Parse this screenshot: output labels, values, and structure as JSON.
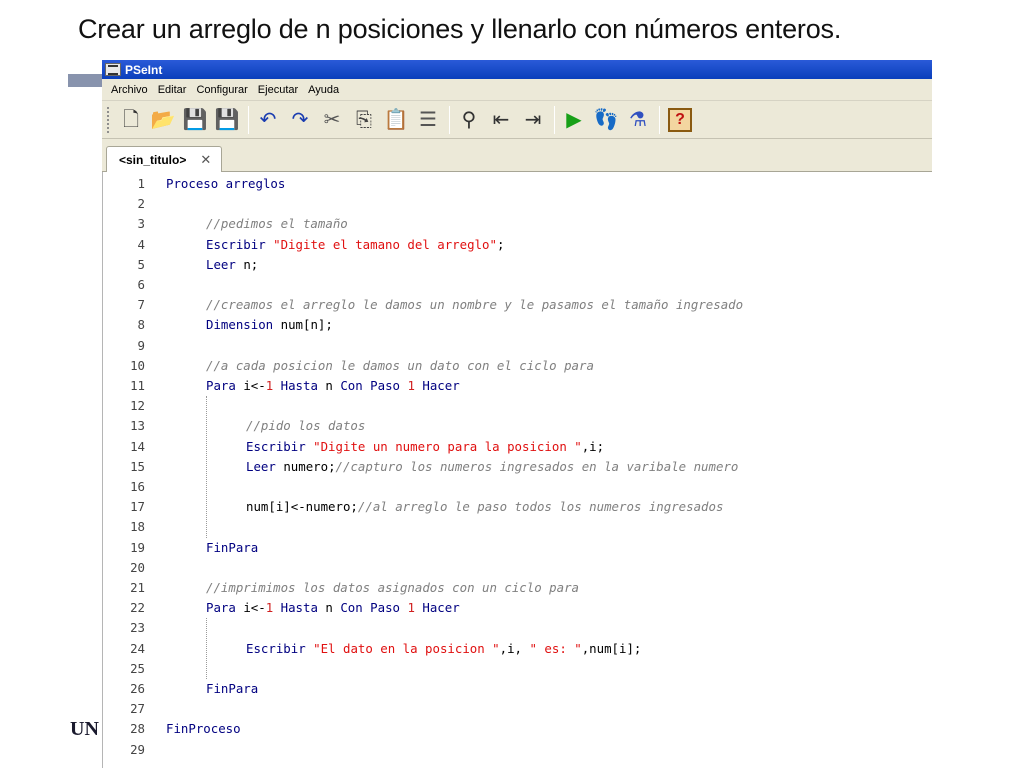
{
  "slide": {
    "title": "Crear un arreglo de n posiciones y llenarlo con números enteros.",
    "footer_fragment": "UN"
  },
  "window": {
    "title": "PSeInt"
  },
  "menu": [
    "Archivo",
    "Editar",
    "Configurar",
    "Ejecutar",
    "Ayuda"
  ],
  "toolbar": [
    {
      "name": "new-file-icon",
      "glyph": "🗋",
      "color": "#333333"
    },
    {
      "name": "open-file-icon",
      "glyph": "📂",
      "color": "#c08a10"
    },
    {
      "name": "save-icon",
      "glyph": "💾",
      "color": "#b02020"
    },
    {
      "name": "save-as-icon",
      "glyph": "💾",
      "color": "#b02020"
    },
    {
      "sep": true
    },
    {
      "name": "undo-icon",
      "glyph": "↶",
      "color": "#1a3cb0"
    },
    {
      "name": "redo-icon",
      "glyph": "↷",
      "color": "#1a3cb0"
    },
    {
      "name": "cut-icon",
      "glyph": "✂",
      "color": "#555555"
    },
    {
      "name": "copy-icon",
      "glyph": "⎘",
      "color": "#444444"
    },
    {
      "name": "paste-icon",
      "glyph": "📋",
      "color": "#8a6a20"
    },
    {
      "name": "indent-icon",
      "glyph": "☰",
      "color": "#555555"
    },
    {
      "sep": true
    },
    {
      "name": "find-icon",
      "glyph": "⚲",
      "color": "#333333"
    },
    {
      "name": "find-previous-icon",
      "glyph": "⇤",
      "color": "#333333"
    },
    {
      "name": "find-next-icon",
      "glyph": "⇥",
      "color": "#333333"
    },
    {
      "sep": true
    },
    {
      "name": "run-icon",
      "glyph": "▶",
      "color": "#18a018"
    },
    {
      "name": "step-by-step-icon",
      "glyph": "👣",
      "color": "#d06020"
    },
    {
      "name": "flowchart-icon",
      "glyph": "⚗",
      "color": "#3050c0"
    },
    {
      "sep": true
    },
    {
      "name": "help-icon",
      "glyph": "?",
      "color": "#c01010"
    }
  ],
  "tab": {
    "label": "<sin_titulo>",
    "close": "✕"
  },
  "colors": {
    "keyword": "#000080",
    "string": "#e01010",
    "comment": "#808080",
    "number": "#d02020",
    "plain": "#000000"
  },
  "code_lines": [
    {
      "n": "1",
      "indent": 0,
      "tokens": [
        [
          "k",
          "Proceso arreglos"
        ]
      ]
    },
    {
      "n": "2",
      "indent": 0,
      "tokens": []
    },
    {
      "n": "3",
      "indent": 1,
      "tokens": [
        [
          "c",
          "//pedimos el tamaño"
        ]
      ]
    },
    {
      "n": "4",
      "indent": 1,
      "tokens": [
        [
          "k",
          "Escribir "
        ],
        [
          "s",
          "\"Digite el tamano del arreglo\""
        ],
        [
          "p",
          ";"
        ]
      ]
    },
    {
      "n": "5",
      "indent": 1,
      "tokens": [
        [
          "k",
          "Leer "
        ],
        [
          "p",
          "n;"
        ]
      ]
    },
    {
      "n": "6",
      "indent": 0,
      "tokens": []
    },
    {
      "n": "7",
      "indent": 1,
      "tokens": [
        [
          "c",
          "//creamos el arreglo le damos un nombre y le pasamos el tamaño ingresado"
        ]
      ]
    },
    {
      "n": "8",
      "indent": 1,
      "tokens": [
        [
          "k",
          "Dimension "
        ],
        [
          "p",
          "num[n];"
        ]
      ]
    },
    {
      "n": "9",
      "indent": 0,
      "tokens": []
    },
    {
      "n": "10",
      "indent": 1,
      "tokens": [
        [
          "c",
          "//a cada posicion le damos un dato con el ciclo para"
        ]
      ]
    },
    {
      "n": "11",
      "indent": 1,
      "tokens": [
        [
          "k",
          "Para "
        ],
        [
          "p",
          "i<-"
        ],
        [
          "n",
          "1"
        ],
        [
          "k",
          " Hasta "
        ],
        [
          "p",
          "n "
        ],
        [
          "k",
          "Con Paso "
        ],
        [
          "n",
          "1"
        ],
        [
          "k",
          " Hacer"
        ]
      ]
    },
    {
      "n": "12",
      "indent": 0,
      "tokens": []
    },
    {
      "n": "13",
      "indent": 2,
      "tokens": [
        [
          "c",
          "//pido los datos"
        ]
      ]
    },
    {
      "n": "14",
      "indent": 2,
      "tokens": [
        [
          "k",
          "Escribir "
        ],
        [
          "s",
          "\"Digite un numero para la posicion \""
        ],
        [
          "p",
          ",i;"
        ]
      ]
    },
    {
      "n": "15",
      "indent": 2,
      "tokens": [
        [
          "k",
          "Leer "
        ],
        [
          "p",
          "numero;"
        ],
        [
          "c",
          "//capturo los numeros ingresados en la varibale numero"
        ]
      ]
    },
    {
      "n": "16",
      "indent": 0,
      "tokens": []
    },
    {
      "n": "17",
      "indent": 2,
      "tokens": [
        [
          "p",
          "num[i]<-numero;"
        ],
        [
          "c",
          "//al arreglo le paso todos los numeros ingresados"
        ]
      ]
    },
    {
      "n": "18",
      "indent": 0,
      "tokens": []
    },
    {
      "n": "19",
      "indent": 1,
      "tokens": [
        [
          "k",
          "FinPara"
        ]
      ]
    },
    {
      "n": "20",
      "indent": 0,
      "tokens": []
    },
    {
      "n": "21",
      "indent": 1,
      "tokens": [
        [
          "c",
          "//imprimimos los datos asignados con un ciclo para"
        ]
      ]
    },
    {
      "n": "22",
      "indent": 1,
      "tokens": [
        [
          "k",
          "Para "
        ],
        [
          "p",
          "i<-"
        ],
        [
          "n",
          "1"
        ],
        [
          "k",
          " Hasta "
        ],
        [
          "p",
          "n "
        ],
        [
          "k",
          "Con Paso "
        ],
        [
          "n",
          "1"
        ],
        [
          "k",
          " Hacer"
        ]
      ]
    },
    {
      "n": "23",
      "indent": 0,
      "tokens": []
    },
    {
      "n": "24",
      "indent": 2,
      "tokens": [
        [
          "k",
          "Escribir "
        ],
        [
          "s",
          "\"El dato en la posicion \""
        ],
        [
          "p",
          ",i, "
        ],
        [
          "s",
          "\" es: \""
        ],
        [
          "p",
          ",num[i];"
        ]
      ]
    },
    {
      "n": "25",
      "indent": 0,
      "tokens": []
    },
    {
      "n": "26",
      "indent": 1,
      "tokens": [
        [
          "k",
          "FinPara"
        ]
      ]
    },
    {
      "n": "27",
      "indent": 0,
      "tokens": []
    },
    {
      "n": "28",
      "indent": 0,
      "tokens": [
        [
          "k",
          "FinProceso"
        ]
      ]
    },
    {
      "n": "29",
      "indent": 0,
      "tokens": []
    }
  ]
}
